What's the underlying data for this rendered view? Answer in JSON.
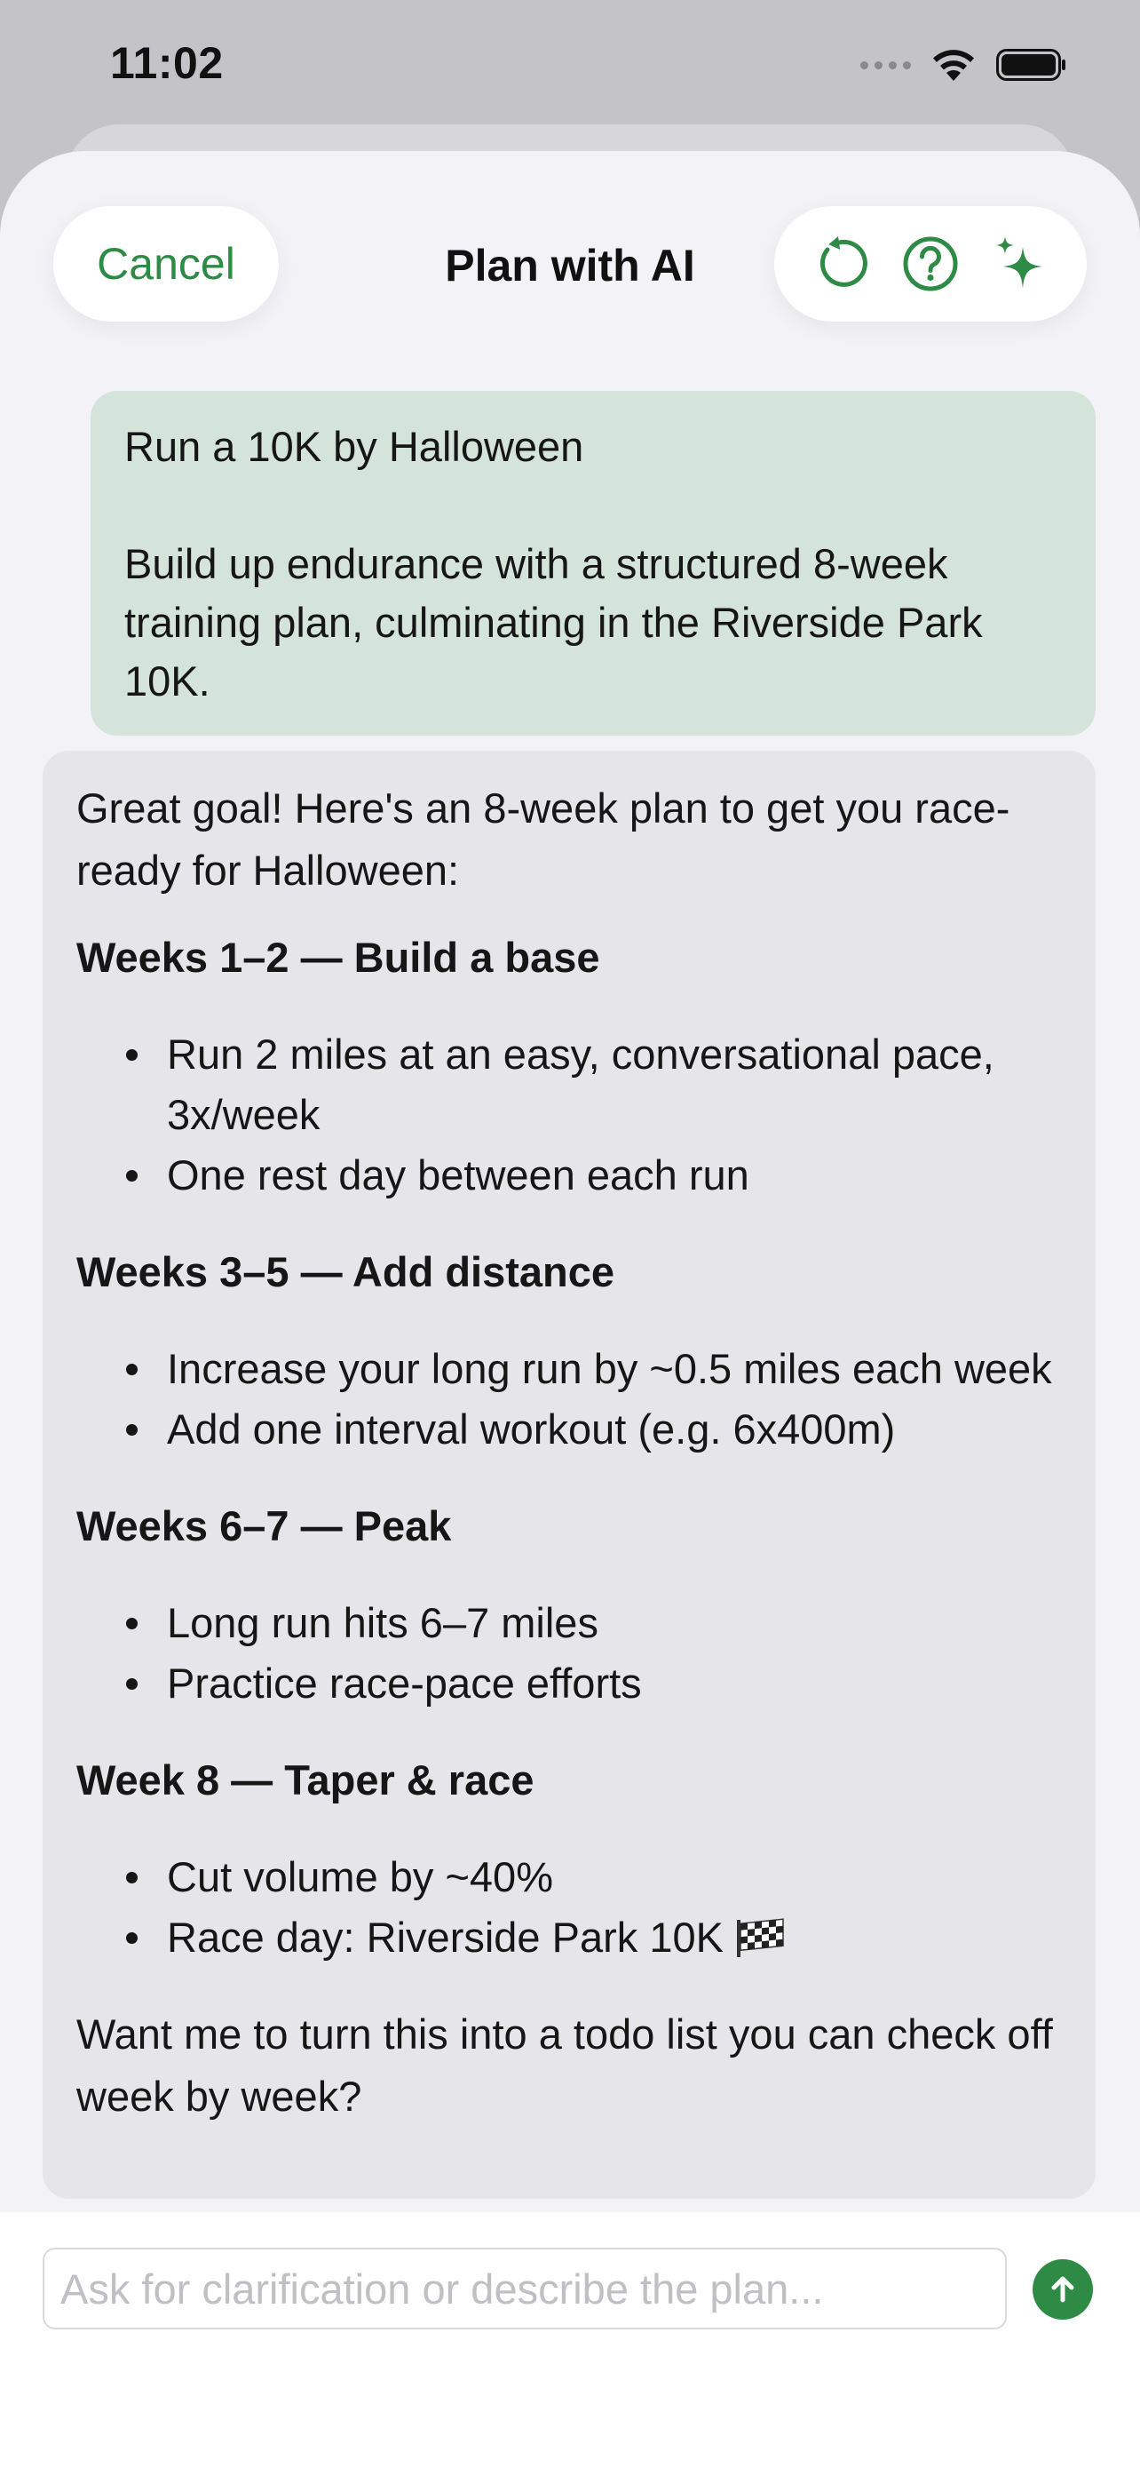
{
  "status_bar": {
    "time": "11:02",
    "icons": [
      "signal-icon",
      "wifi-icon",
      "battery-icon"
    ]
  },
  "nav": {
    "cancel_label": "Cancel",
    "title": "Plan with AI",
    "actions": [
      "reset-icon",
      "help-icon",
      "sparkle-icon"
    ]
  },
  "colors": {
    "accent": "#2e8b45",
    "user_bubble": "#d5e4da",
    "ai_bubble": "#e5e5ea",
    "sheet": "#f2f2f7"
  },
  "user_message": {
    "title": "Run a 10K by Halloween",
    "body": "Build up endurance with a structured 8-week training plan, culminating in the Riverside Park 10K."
  },
  "ai_message": {
    "intro": "Great goal! Here's an 8-week plan to get you race-ready for Halloween:",
    "sections": [
      {
        "heading": "Weeks 1–2 — Build a base",
        "items": [
          "Run 2 miles at an easy, conversational pace, 3x/week",
          "One rest day between each run"
        ]
      },
      {
        "heading": "Weeks 3–5 — Add distance",
        "items": [
          "Increase your long run by ~0.5 miles each week",
          "Add one interval workout (e.g. 6x400m)"
        ]
      },
      {
        "heading": "Weeks 6–7 — Peak",
        "items": [
          "Long run hits 6–7 miles",
          "Practice race-pace efforts"
        ]
      },
      {
        "heading": "Week 8 — Taper & race",
        "items": [
          "Cut volume by ~40%",
          "Race day: Riverside Park 10K"
        ]
      }
    ],
    "outro": "Want me to turn this into a todo list you can check off week by week?"
  },
  "composer": {
    "placeholder": "Ask for clarification or describe the plan...",
    "value": ""
  }
}
